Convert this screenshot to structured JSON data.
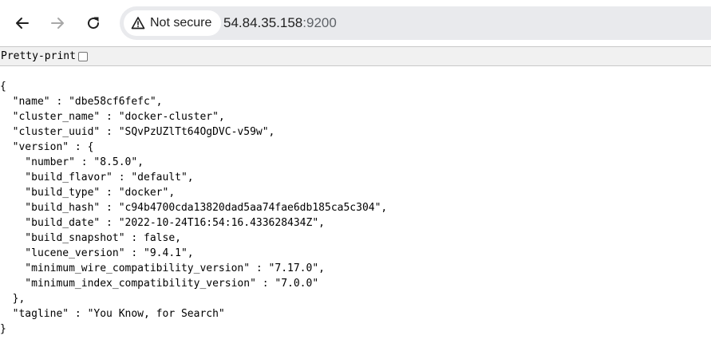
{
  "browser": {
    "security_label": "Not secure",
    "url_host": "54.84.35.158",
    "url_port": ":9200"
  },
  "page": {
    "pretty_print_label": "Pretty-print",
    "pretty_print_checked": false,
    "json_lines": [
      "{",
      "  \"name\" : \"dbe58cf6fefc\",",
      "  \"cluster_name\" : \"docker-cluster\",",
      "  \"cluster_uuid\" : \"SQvPzUZlTt64OgDVC-v59w\",",
      "  \"version\" : {",
      "    \"number\" : \"8.5.0\",",
      "    \"build_flavor\" : \"default\",",
      "    \"build_type\" : \"docker\",",
      "    \"build_hash\" : \"c94b4700cda13820dad5aa74fae6db185ca5c304\",",
      "    \"build_date\" : \"2022-10-24T16:54:16.433628434Z\",",
      "    \"build_snapshot\" : false,",
      "    \"lucene_version\" : \"9.4.1\",",
      "    \"minimum_wire_compatibility_version\" : \"7.17.0\",",
      "    \"minimum_index_compatibility_version\" : \"7.0.0\"",
      "  },",
      "  \"tagline\" : \"You Know, for Search\"",
      "}"
    ]
  }
}
